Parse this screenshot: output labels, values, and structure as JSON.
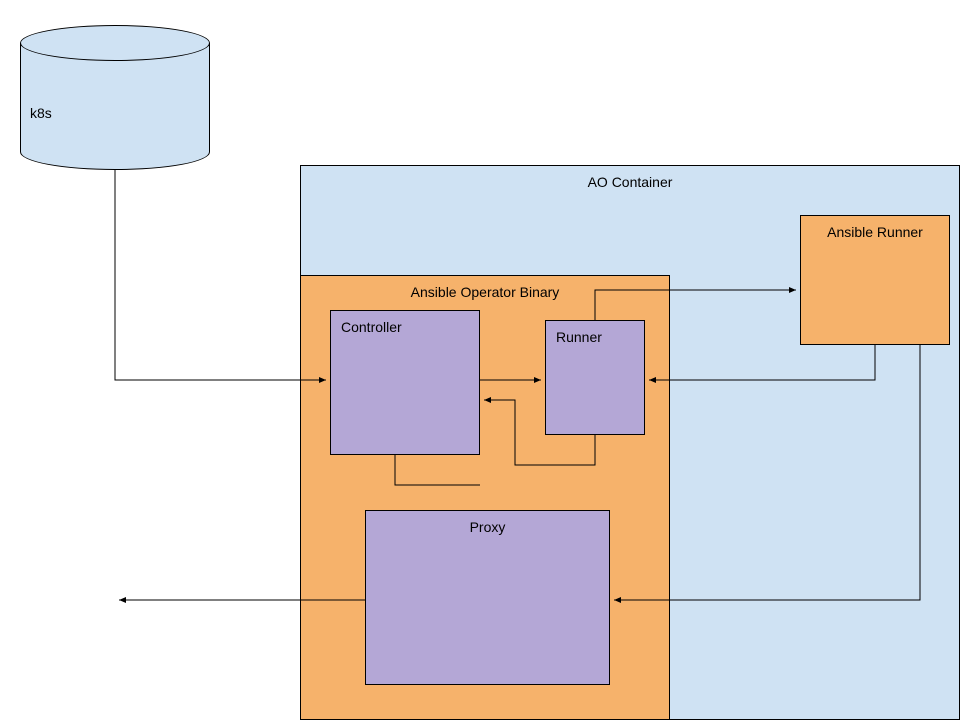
{
  "nodes": {
    "k8s": {
      "label": "k8s"
    },
    "ao_container": {
      "label": "AO Container"
    },
    "ansible_binary": {
      "label": "Ansible Operator Binary"
    },
    "ansible_runner": {
      "label": "Ansible Runner"
    },
    "controller": {
      "label": "Controller"
    },
    "runner": {
      "label": "Runner"
    },
    "proxy": {
      "label": "Proxy"
    }
  },
  "colors": {
    "light_blue": "#cfe2f3",
    "orange": "#f6b26b",
    "purple": "#b4a7d6"
  }
}
